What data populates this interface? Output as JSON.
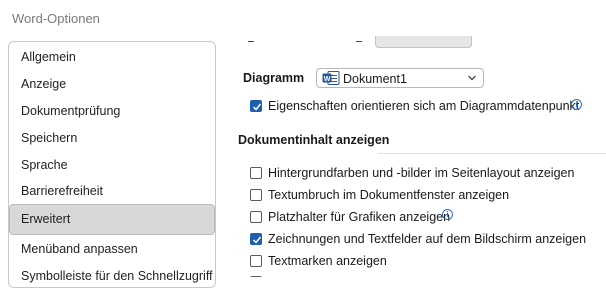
{
  "window": {
    "title": "Word-Optionen"
  },
  "sidebar": {
    "items": [
      {
        "label": "Allgemein"
      },
      {
        "label": "Anzeige"
      },
      {
        "label": "Dokumentprüfung"
      },
      {
        "label": "Speichern"
      },
      {
        "label": "Sprache"
      },
      {
        "label": "Barrierefreiheit"
      },
      {
        "label": "Erweitert",
        "selected": true
      },
      {
        "label": "Menüband anpassen"
      },
      {
        "label": "Symbolleiste für den Schnellzugriff"
      }
    ]
  },
  "main": {
    "diagram": {
      "label": "Diagramm",
      "dropdown_value": "Dokument1",
      "option": {
        "label": "Eigenschaften orientieren sich am Diagrammdatenpunkt",
        "checked": true
      }
    },
    "section_title": "Dokumentinhalt anzeigen",
    "options": [
      {
        "label": "Hintergrundfarben und -bilder im Seitenlayout anzeigen",
        "checked": false
      },
      {
        "label": "Textumbruch im Dokumentfenster anzeigen",
        "checked": false
      },
      {
        "label": "Platzhalter für Grafiken anzeigen",
        "checked": false
      },
      {
        "label": "Zeichnungen und Textfelder auf dem Bildschirm anzeigen",
        "checked": true
      },
      {
        "label": "Textmarken anzeigen",
        "checked": false
      }
    ]
  },
  "colors": {
    "accent": "#1f5fb0",
    "selected_bg": "#d8d8d8",
    "info": "#2f6fd0"
  }
}
